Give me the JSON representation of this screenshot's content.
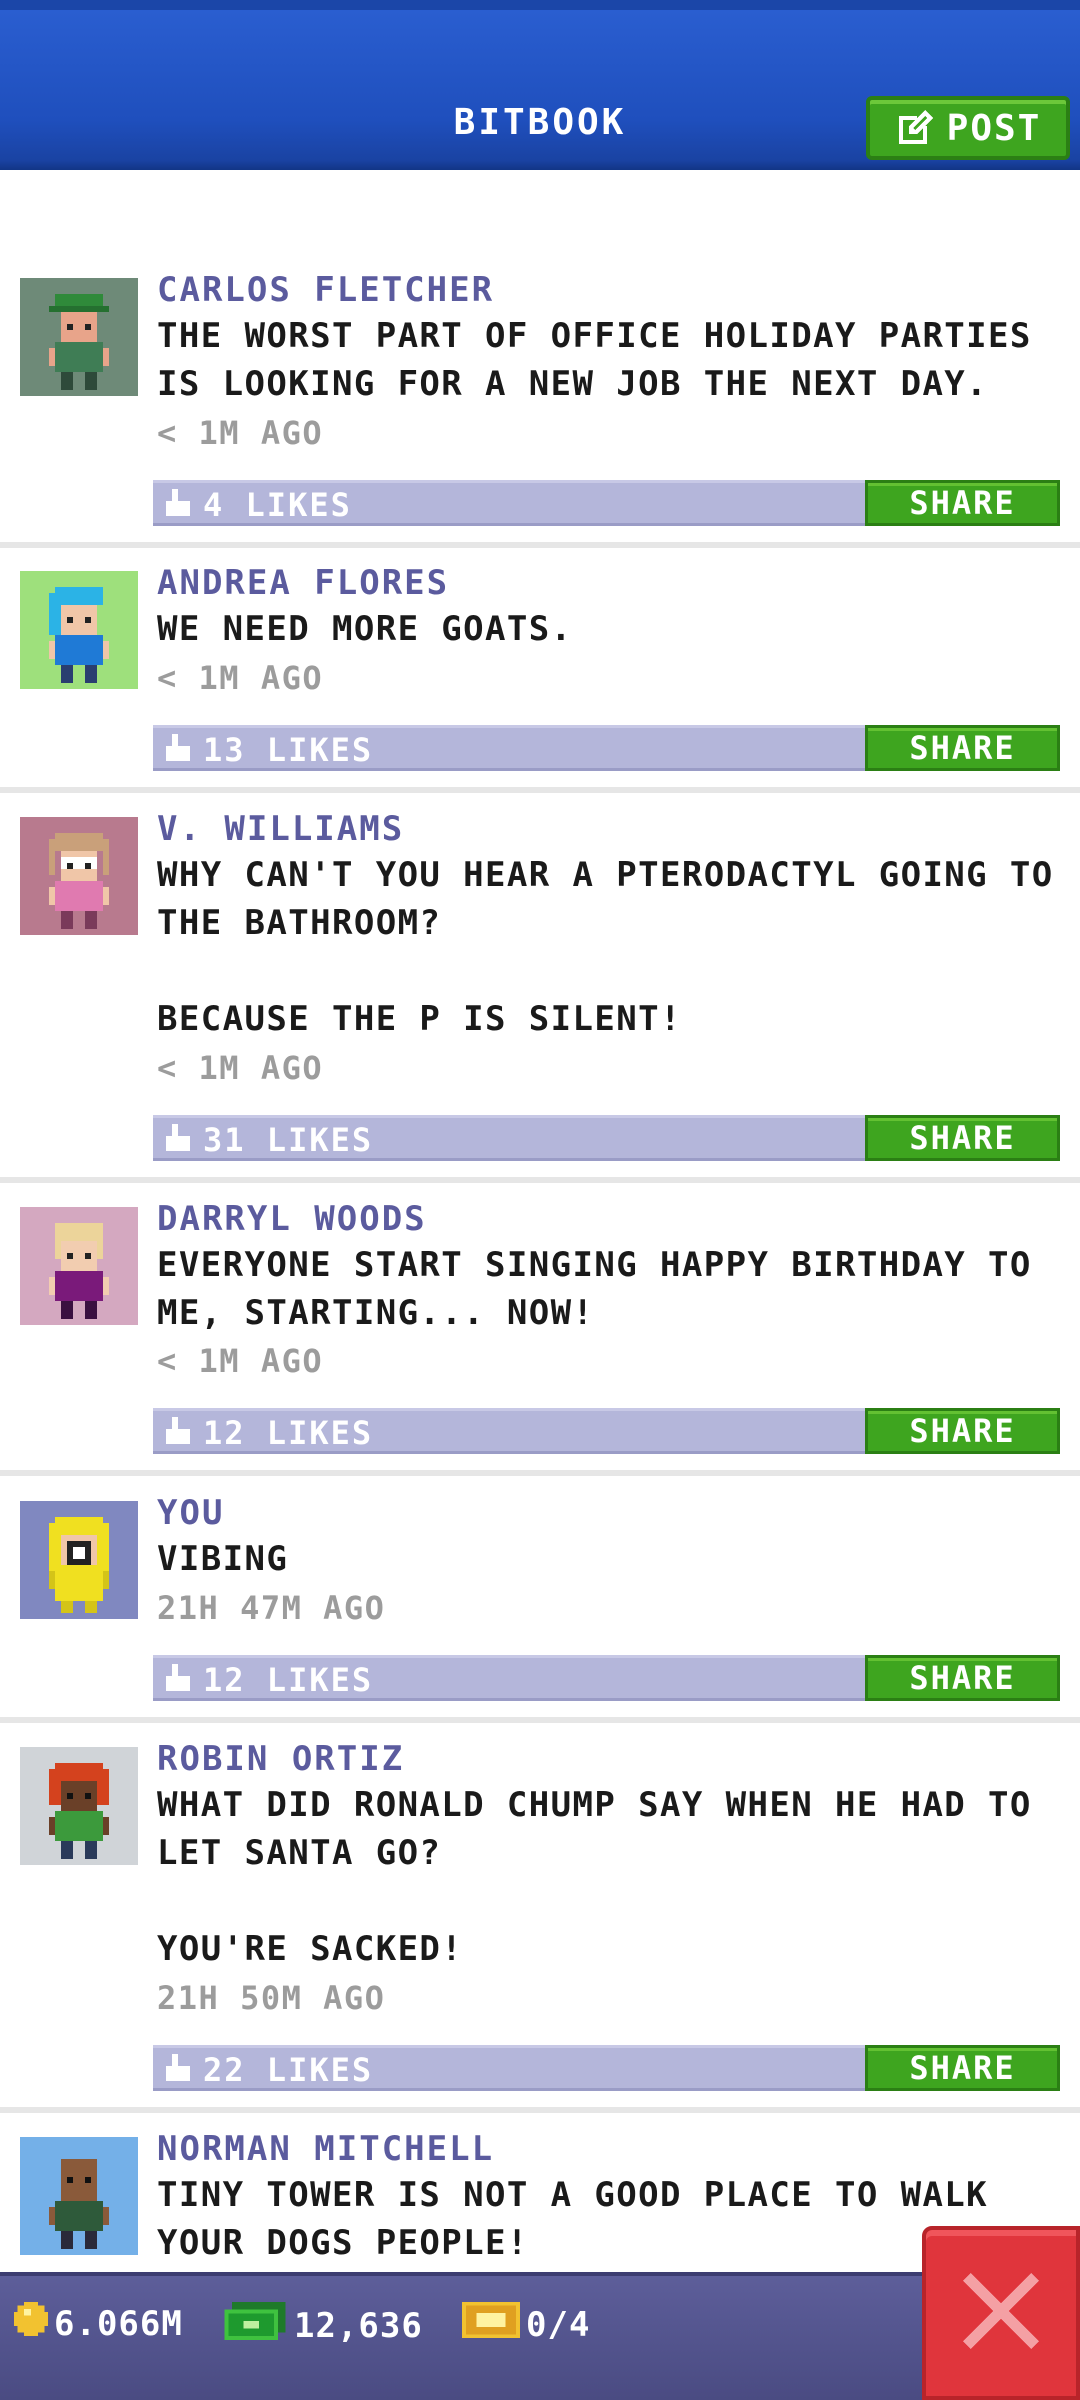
{
  "header": {
    "title": "BITBOOK",
    "post_label": "POST"
  },
  "colors": {
    "header_blue": "#1f4fbd",
    "name_purple": "#5b5b9e",
    "likes_bar": "#b4b6da",
    "share_green": "#3ea51f",
    "close_red": "#e0353c"
  },
  "feed": {
    "posts": [
      {
        "name": "CARLOS FLETCHER",
        "text": "THE WORST PART OF OFFICE HOLIDAY PARTIES IS LOOKING FOR A NEW JOB THE NEXT DAY.",
        "time": "< 1M AGO",
        "likes": "4 LIKES",
        "share": "SHARE",
        "avatar": "avatar-green-cap"
      },
      {
        "name": "ANDREA FLORES",
        "text": "WE NEED MORE GOATS.",
        "time": "< 1M AGO",
        "likes": "13 LIKES",
        "share": "SHARE",
        "avatar": "avatar-blue-hair"
      },
      {
        "name": "V. WILLIAMS",
        "text": "WHY CAN'T YOU HEAR A PTERODACTYL GOING TO THE BATHROOM?\n\nBECAUSE THE P IS SILENT!",
        "time": "< 1M AGO",
        "likes": "31 LIKES",
        "share": "SHARE",
        "avatar": "avatar-glasses"
      },
      {
        "name": "DARRYL WOODS",
        "text": "EVERYONE START SINGING HAPPY BIRTHDAY TO ME, STARTING... NOW!",
        "time": "< 1M AGO",
        "likes": "12 LIKES",
        "share": "SHARE",
        "avatar": "avatar-blond"
      },
      {
        "name": "YOU",
        "text": "VIBING",
        "time": "21H 47M AGO",
        "likes": "12 LIKES",
        "share": "SHARE",
        "avatar": "avatar-yellow-raincoat"
      },
      {
        "name": "ROBIN ORTIZ",
        "text": "WHAT DID RONALD CHUMP SAY WHEN HE HAD TO LET SANTA GO?\n\nYOU'RE SACKED!",
        "time": "21H 50M AGO",
        "likes": "22 LIKES",
        "share": "SHARE",
        "avatar": "avatar-red-hair"
      },
      {
        "name": "NORMAN MITCHELL",
        "text": "TINY TOWER IS NOT A GOOD PLACE TO WALK YOUR DOGS PEOPLE!",
        "avatar": "avatar-bald"
      }
    ]
  },
  "status": {
    "coins": "6.066M",
    "bux": "12,636",
    "tickets": "0/4"
  }
}
